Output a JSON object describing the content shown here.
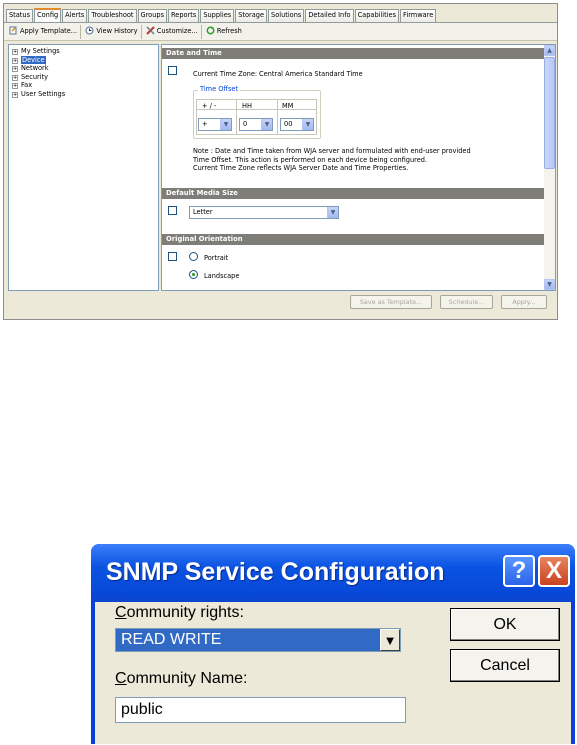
{
  "wja": {
    "tabs": [
      "Status",
      "Config",
      "Alerts",
      "Troubleshoot",
      "Groups",
      "Reports",
      "Supplies",
      "Storage",
      "Solutions",
      "Detailed Info",
      "Capabilities",
      "Firmware"
    ],
    "active_tab": "Config",
    "toolbar": {
      "apply_template": "Apply Template...",
      "view_history": "View History",
      "customize": "Customize...",
      "refresh": "Refresh"
    },
    "tree": [
      {
        "label": "My Settings",
        "selected": false
      },
      {
        "label": "Device",
        "selected": true
      },
      {
        "label": "Network",
        "selected": false
      },
      {
        "label": "Security",
        "selected": false
      },
      {
        "label": "Fax",
        "selected": false
      },
      {
        "label": "User Settings",
        "selected": false
      }
    ],
    "date_time": {
      "header": "Date and Time",
      "tz_label": "Current Time Zone:",
      "tz_value": "Central America Standard Time",
      "offset_group": "Time Offset",
      "col_sign": "+ / -",
      "col_hh": "HH",
      "col_mm": "MM",
      "sign_value": "+",
      "hh_value": "0",
      "mm_value": "00",
      "note_1": "Note : Date and Time taken from WJA server and formulated with end-user provided",
      "note_2": "Time Offset. This action is performed on each device being configured.",
      "note_3": "Current Time Zone reflects WJA Server Date and Time Properties."
    },
    "media": {
      "header": "Default Media Size",
      "value": "Letter"
    },
    "orientation": {
      "header": "Original Orientation",
      "portrait": "Portrait",
      "landscape": "Landscape",
      "selected": "Landscape"
    },
    "buttons": {
      "save_template": "Save as Template...",
      "schedule": "Schedule...",
      "apply": "Apply..."
    }
  },
  "snmp": {
    "title": "SNMP Service Configuration",
    "help": "?",
    "close": "X",
    "rights_label_u": "C",
    "rights_label_rest": "ommunity rights:",
    "rights_value": "READ WRITE",
    "name_label_u": "C",
    "name_label_rest": "ommunity Name:",
    "name_value": "public",
    "ok": "OK",
    "cancel": "Cancel"
  },
  "colors": {
    "xp_title_blue": "#0a53e2",
    "selection_blue": "#316ac5",
    "section_header_grey": "#7e7d78",
    "dialog_face": "#ece9d8"
  }
}
